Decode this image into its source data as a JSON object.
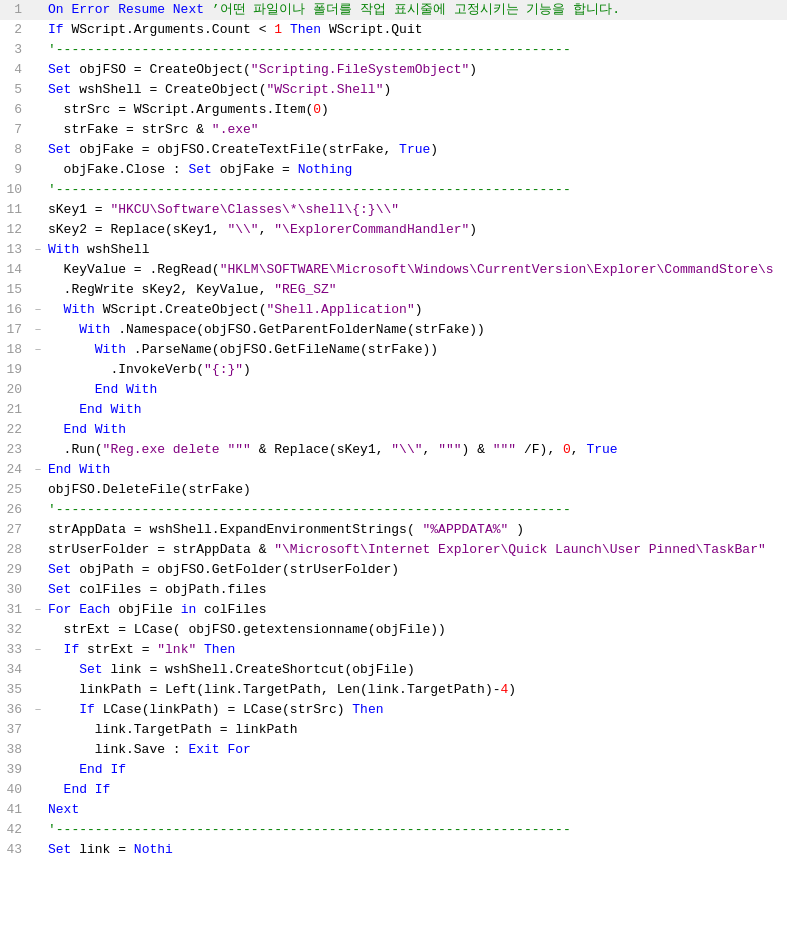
{
  "lines": [
    {
      "num": 1,
      "fold": "",
      "tokens": [
        {
          "t": "kw",
          "v": "On Error Resume Next"
        },
        {
          "t": "comment",
          "v": " ’어떤 파일이나 폴더를 작업 표시줄에 고정시키는 기능을 합니다."
        }
      ]
    },
    {
      "num": 2,
      "fold": "",
      "tokens": [
        {
          "t": "kw",
          "v": "If"
        },
        {
          "t": "var",
          "v": " WScript.Arguments.Count "
        },
        {
          "t": "op",
          "v": "<"
        },
        {
          "t": "var",
          "v": " "
        },
        {
          "t": "num",
          "v": "1"
        },
        {
          "t": "kw",
          "v": " Then"
        },
        {
          "t": "var",
          "v": " WScript.Quit"
        }
      ]
    },
    {
      "num": 3,
      "fold": "",
      "tokens": [
        {
          "t": "comment",
          "v": "'------------------------------------------------------------------"
        }
      ]
    },
    {
      "num": 4,
      "fold": "",
      "tokens": [
        {
          "t": "kw",
          "v": "Set"
        },
        {
          "t": "var",
          "v": " objFSO "
        },
        {
          "t": "op",
          "v": "="
        },
        {
          "t": "var",
          "v": " CreateObject("
        },
        {
          "t": "str",
          "v": "\"Scripting.FileSystemObject\""
        },
        {
          "t": "var",
          "v": ")"
        }
      ]
    },
    {
      "num": 5,
      "fold": "",
      "tokens": [
        {
          "t": "kw",
          "v": "Set"
        },
        {
          "t": "var",
          "v": " wshShell "
        },
        {
          "t": "op",
          "v": "="
        },
        {
          "t": "var",
          "v": " CreateObject("
        },
        {
          "t": "str",
          "v": "\"WScript.Shell\""
        },
        {
          "t": "var",
          "v": ")"
        }
      ]
    },
    {
      "num": 6,
      "fold": "",
      "tokens": [
        {
          "t": "var",
          "v": "  strSrc "
        },
        {
          "t": "op",
          "v": "="
        },
        {
          "t": "var",
          "v": " WScript.Arguments.Item("
        },
        {
          "t": "num",
          "v": "0"
        },
        {
          "t": "var",
          "v": ")"
        }
      ]
    },
    {
      "num": 7,
      "fold": "",
      "tokens": [
        {
          "t": "var",
          "v": "  strFake "
        },
        {
          "t": "op",
          "v": "="
        },
        {
          "t": "var",
          "v": " strSrc "
        },
        {
          "t": "op",
          "v": "&"
        },
        {
          "t": "str",
          "v": " \".exe\""
        }
      ]
    },
    {
      "num": 8,
      "fold": "",
      "tokens": [
        {
          "t": "kw",
          "v": "Set"
        },
        {
          "t": "var",
          "v": " objFake "
        },
        {
          "t": "op",
          "v": "="
        },
        {
          "t": "var",
          "v": " objFSO.CreateTextFile(strFake, "
        },
        {
          "t": "kw",
          "v": "True"
        },
        {
          "t": "var",
          "v": ")"
        }
      ]
    },
    {
      "num": 9,
      "fold": "",
      "tokens": [
        {
          "t": "var",
          "v": "  objFake.Close "
        },
        {
          "t": "op",
          "v": ":"
        },
        {
          "t": "kw",
          "v": " Set"
        },
        {
          "t": "var",
          "v": " objFake "
        },
        {
          "t": "op",
          "v": "="
        },
        {
          "t": "kw",
          "v": " Nothing"
        }
      ]
    },
    {
      "num": 10,
      "fold": "",
      "tokens": [
        {
          "t": "comment",
          "v": "'------------------------------------------------------------------"
        }
      ]
    },
    {
      "num": 11,
      "fold": "",
      "tokens": [
        {
          "t": "var",
          "v": "sKey1 "
        },
        {
          "t": "op",
          "v": "="
        },
        {
          "t": "str",
          "v": " \"HKCU\\Software\\Classes\\*\\shell\\{:}\\\\\""
        }
      ]
    },
    {
      "num": 12,
      "fold": "",
      "tokens": [
        {
          "t": "var",
          "v": "sKey2 "
        },
        {
          "t": "op",
          "v": "="
        },
        {
          "t": "var",
          "v": " Replace(sKey1, "
        },
        {
          "t": "str",
          "v": "\"\\\\\""
        },
        {
          "t": "var",
          "v": ", "
        },
        {
          "t": "str",
          "v": "\"\\ExplorerCommandHandler\""
        },
        {
          "t": "var",
          "v": ")"
        }
      ]
    },
    {
      "num": 13,
      "fold": "-",
      "tokens": [
        {
          "t": "kw",
          "v": "With"
        },
        {
          "t": "var",
          "v": " wshShell"
        }
      ]
    },
    {
      "num": 14,
      "fold": "",
      "tokens": [
        {
          "t": "var",
          "v": "  KeyValue "
        },
        {
          "t": "op",
          "v": "="
        },
        {
          "t": "var",
          "v": " .RegRead("
        },
        {
          "t": "str",
          "v": "\"HKLM\\SOFTWARE\\Microsoft\\Windows\\CurrentVersion\\Explorer\\CommandStore\\s"
        },
        {
          "t": "var",
          "v": ""
        }
      ]
    },
    {
      "num": 15,
      "fold": "",
      "tokens": [
        {
          "t": "var",
          "v": "  .RegWrite sKey2, KeyValue, "
        },
        {
          "t": "str",
          "v": "\"REG_SZ\""
        }
      ]
    },
    {
      "num": 16,
      "fold": "-",
      "tokens": [
        {
          "t": "var",
          "v": "  "
        },
        {
          "t": "kw",
          "v": "With"
        },
        {
          "t": "var",
          "v": " WScript.CreateObject("
        },
        {
          "t": "str",
          "v": "\"Shell.Application\""
        },
        {
          "t": "var",
          "v": ")"
        }
      ]
    },
    {
      "num": 17,
      "fold": "-",
      "tokens": [
        {
          "t": "var",
          "v": "    "
        },
        {
          "t": "kw",
          "v": "With"
        },
        {
          "t": "var",
          "v": " .Namespace(objFSO.GetParentFolderName(strFake))"
        }
      ]
    },
    {
      "num": 18,
      "fold": "-",
      "tokens": [
        {
          "t": "var",
          "v": "      "
        },
        {
          "t": "kw",
          "v": "With"
        },
        {
          "t": "var",
          "v": " .ParseName(objFSO.GetFileName(strFake))"
        }
      ]
    },
    {
      "num": 19,
      "fold": "",
      "tokens": [
        {
          "t": "var",
          "v": "        .InvokeVerb("
        },
        {
          "t": "str",
          "v": "\"{:}\""
        },
        {
          "t": "var",
          "v": ")"
        }
      ]
    },
    {
      "num": 20,
      "fold": "",
      "tokens": [
        {
          "t": "var",
          "v": "      "
        },
        {
          "t": "kw",
          "v": "End With"
        }
      ]
    },
    {
      "num": 21,
      "fold": "",
      "tokens": [
        {
          "t": "var",
          "v": "    "
        },
        {
          "t": "kw",
          "v": "End With"
        }
      ]
    },
    {
      "num": 22,
      "fold": "",
      "tokens": [
        {
          "t": "var",
          "v": "  "
        },
        {
          "t": "kw",
          "v": "End With"
        }
      ]
    },
    {
      "num": 23,
      "fold": "",
      "tokens": [
        {
          "t": "var",
          "v": "  .Run("
        },
        {
          "t": "str",
          "v": "\"Reg.exe delete \"\"\""
        },
        {
          "t": "var",
          "v": " "
        },
        {
          "t": "op",
          "v": "&"
        },
        {
          "t": "var",
          "v": " Replace(sKey1, "
        },
        {
          "t": "str",
          "v": "\"\\\\\""
        },
        {
          "t": "var",
          "v": ", "
        },
        {
          "t": "str",
          "v": "\"\"\""
        },
        {
          "t": "var",
          "v": ") "
        },
        {
          "t": "op",
          "v": "&"
        },
        {
          "t": "str",
          "v": " \"\"\""
        },
        {
          "t": "var",
          "v": " /F), "
        },
        {
          "t": "num",
          "v": "0"
        },
        {
          "t": "var",
          "v": ", "
        },
        {
          "t": "kw",
          "v": "True"
        }
      ]
    },
    {
      "num": 24,
      "fold": "-",
      "tokens": [
        {
          "t": "kw",
          "v": "End With"
        }
      ]
    },
    {
      "num": 25,
      "fold": "",
      "tokens": [
        {
          "t": "var",
          "v": "objFSO.DeleteFile(strFake)"
        }
      ]
    },
    {
      "num": 26,
      "fold": "",
      "tokens": [
        {
          "t": "comment",
          "v": "'------------------------------------------------------------------"
        }
      ]
    },
    {
      "num": 27,
      "fold": "",
      "tokens": [
        {
          "t": "var",
          "v": "strAppData "
        },
        {
          "t": "op",
          "v": "="
        },
        {
          "t": "var",
          "v": " wshShell.ExpandEnvironmentStrings( "
        },
        {
          "t": "str",
          "v": "\"%APPDATA%\""
        },
        {
          "t": "var",
          "v": " )"
        }
      ]
    },
    {
      "num": 28,
      "fold": "",
      "tokens": [
        {
          "t": "var",
          "v": "strUserFolder "
        },
        {
          "t": "op",
          "v": "="
        },
        {
          "t": "var",
          "v": " strAppData "
        },
        {
          "t": "op",
          "v": "&"
        },
        {
          "t": "str",
          "v": " \"\\Microsoft\\Internet Explorer\\Quick Launch\\User Pinned\\TaskBar\""
        }
      ]
    },
    {
      "num": 29,
      "fold": "",
      "tokens": [
        {
          "t": "kw",
          "v": "Set"
        },
        {
          "t": "var",
          "v": " objPath "
        },
        {
          "t": "op",
          "v": "="
        },
        {
          "t": "var",
          "v": " objFSO.GetFolder(strUserFolder)"
        }
      ]
    },
    {
      "num": 30,
      "fold": "",
      "tokens": [
        {
          "t": "kw",
          "v": "Set"
        },
        {
          "t": "var",
          "v": " colFiles "
        },
        {
          "t": "op",
          "v": "="
        },
        {
          "t": "var",
          "v": " objPath.files"
        }
      ]
    },
    {
      "num": 31,
      "fold": "-",
      "tokens": [
        {
          "t": "kw",
          "v": "For Each"
        },
        {
          "t": "var",
          "v": " objFile "
        },
        {
          "t": "kw",
          "v": "in"
        },
        {
          "t": "var",
          "v": " colFiles"
        }
      ]
    },
    {
      "num": 32,
      "fold": "",
      "tokens": [
        {
          "t": "var",
          "v": "  strExt "
        },
        {
          "t": "op",
          "v": "="
        },
        {
          "t": "var",
          "v": " LCase( objFSO.getextensionname(objFile))"
        }
      ]
    },
    {
      "num": 33,
      "fold": "-",
      "tokens": [
        {
          "t": "var",
          "v": "  "
        },
        {
          "t": "kw",
          "v": "If"
        },
        {
          "t": "var",
          "v": " strExt "
        },
        {
          "t": "op",
          "v": "="
        },
        {
          "t": "str",
          "v": " \"lnk\""
        },
        {
          "t": "kw",
          "v": " Then"
        }
      ]
    },
    {
      "num": 34,
      "fold": "",
      "tokens": [
        {
          "t": "kw",
          "v": "    Set"
        },
        {
          "t": "var",
          "v": " link "
        },
        {
          "t": "op",
          "v": "="
        },
        {
          "t": "var",
          "v": " wshShell.CreateShortcut(objFile)"
        }
      ]
    },
    {
      "num": 35,
      "fold": "",
      "tokens": [
        {
          "t": "var",
          "v": "    linkPath "
        },
        {
          "t": "op",
          "v": "="
        },
        {
          "t": "var",
          "v": " Left(link.TargetPath, Len(link.TargetPath)"
        },
        {
          "t": "op",
          "v": "-"
        },
        {
          "t": "num",
          "v": "4"
        },
        {
          "t": "var",
          "v": ")"
        }
      ]
    },
    {
      "num": 36,
      "fold": "-",
      "tokens": [
        {
          "t": "var",
          "v": "    "
        },
        {
          "t": "kw",
          "v": "If"
        },
        {
          "t": "var",
          "v": " LCase(linkPath) "
        },
        {
          "t": "op",
          "v": "="
        },
        {
          "t": "var",
          "v": " LCase(strSrc) "
        },
        {
          "t": "kw",
          "v": "Then"
        }
      ]
    },
    {
      "num": 37,
      "fold": "",
      "tokens": [
        {
          "t": "var",
          "v": "      link.TargetPath "
        },
        {
          "t": "op",
          "v": "="
        },
        {
          "t": "var",
          "v": " linkPath"
        }
      ]
    },
    {
      "num": 38,
      "fold": "",
      "tokens": [
        {
          "t": "var",
          "v": "      link.Save "
        },
        {
          "t": "op",
          "v": ":"
        },
        {
          "t": "kw",
          "v": " Exit For"
        }
      ]
    },
    {
      "num": 39,
      "fold": "",
      "tokens": [
        {
          "t": "var",
          "v": "    "
        },
        {
          "t": "kw",
          "v": "End If"
        }
      ]
    },
    {
      "num": 40,
      "fold": "",
      "tokens": [
        {
          "t": "var",
          "v": "  "
        },
        {
          "t": "kw",
          "v": "End If"
        }
      ]
    },
    {
      "num": 41,
      "fold": "",
      "tokens": [
        {
          "t": "kw",
          "v": "Next"
        }
      ]
    },
    {
      "num": 42,
      "fold": "",
      "tokens": [
        {
          "t": "comment",
          "v": "'------------------------------------------------------------------"
        }
      ]
    },
    {
      "num": 43,
      "fold": "",
      "tokens": [
        {
          "t": "kw",
          "v": "Set"
        },
        {
          "t": "var",
          "v": " link "
        },
        {
          "t": "op",
          "v": "="
        },
        {
          "t": "kw",
          "v": " Nothi"
        }
      ]
    }
  ]
}
